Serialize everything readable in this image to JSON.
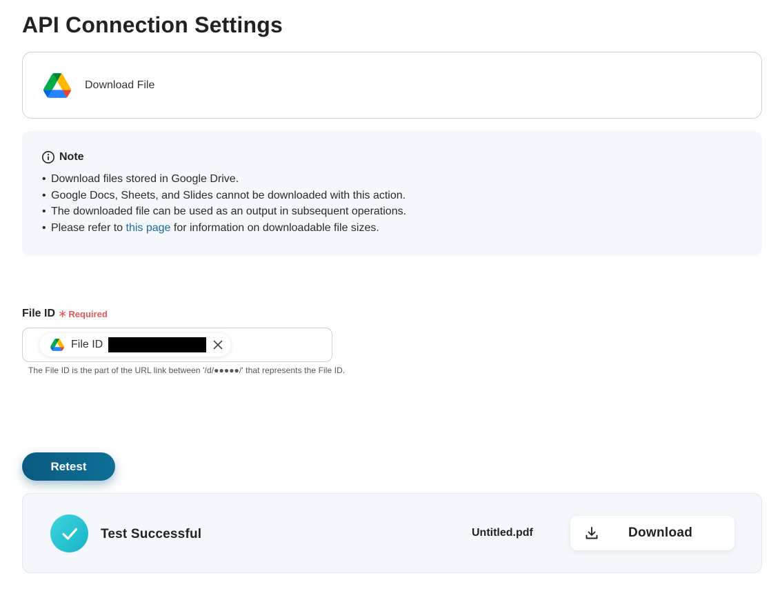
{
  "page": {
    "title": "API Connection Settings"
  },
  "action": {
    "label": "Download File",
    "icon": "google-drive-icon"
  },
  "note": {
    "title": "Note",
    "items": [
      "Download files stored in Google Drive.",
      "Google Docs, Sheets, and Slides cannot be downloaded with this action.",
      "The downloaded file can be used as an output in subsequent operations."
    ],
    "last_item": {
      "prefix": "Please refer to ",
      "link_text": "this page",
      "suffix": " for information on downloadable file sizes."
    }
  },
  "field": {
    "label": "File ID",
    "required_mark": "∗",
    "required_text": "Required",
    "chip_label": "File ID",
    "helper": "The File ID is the part of the URL link between '/d/●●●●●/' that represents the File ID."
  },
  "retest": {
    "label": "Retest"
  },
  "result": {
    "status": "Test Successful",
    "file_name": "Untitled.pdf",
    "download_label": "Download"
  },
  "colors": {
    "accent": "#0f6f96",
    "link": "#1a6a9e",
    "required": "#e05a5a",
    "success": "#16b4c8",
    "note_bg": "#f4f7fb"
  }
}
